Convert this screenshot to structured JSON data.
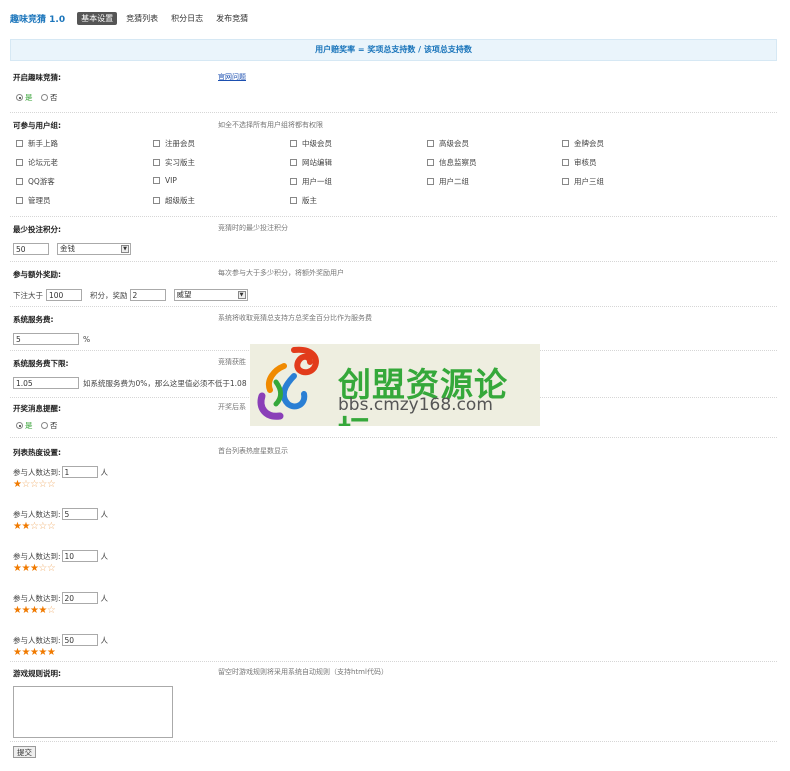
{
  "app": {
    "title": "趣味竞猜 1.0"
  },
  "tabs": [
    {
      "label": "基本设置",
      "active": true
    },
    {
      "label": "竞猜列表",
      "active": false
    },
    {
      "label": "积分日志",
      "active": false
    },
    {
      "label": "发布竞猜",
      "active": false
    }
  ],
  "banner": "用户赔奖率 = 奖项总支持数 / 该项总支持数",
  "enable": {
    "label": "开启趣味竞猜:",
    "link": "官网问题",
    "yes": "是",
    "no": "否",
    "selected": "yes"
  },
  "groups": {
    "label": "可参与用户组:",
    "desc": "如全不选择所有用户组将都有权限",
    "items": [
      "新手上路",
      "注册会员",
      "中级会员",
      "高级会员",
      "金牌会员",
      "论坛元老",
      "实习版主",
      "网站编辑",
      "信息监察员",
      "审核员",
      "QQ游客",
      "VIP",
      "用户一组",
      "用户二组",
      "用户三组",
      "管理员",
      "超级版主",
      "版主"
    ]
  },
  "min_bet": {
    "label": "最少投注积分:",
    "desc": "竞猜时的最少投注积分",
    "value": "50",
    "currency": "金钱"
  },
  "extra": {
    "label": "参与额外奖励:",
    "desc": "每次参与大于多少积分，将额外奖励用户",
    "prefix": "下注大于",
    "value": "100",
    "middle": "积分，奖励",
    "reward": "2",
    "currency": "威望"
  },
  "fee": {
    "label": "系统服务费:",
    "desc": "系统将收取竞猜总支持方总奖金百分比作为服务费",
    "value": "5",
    "unit": "%"
  },
  "fee_min": {
    "label": "系统服务费下限:",
    "desc": "竞猜获胜",
    "value": "1.05",
    "note": "如系统服务费为0%，那么这里值必须不低于1.08"
  },
  "notify": {
    "label": "开奖消息提醒:",
    "desc": "开奖后系",
    "yes": "是",
    "no": "否",
    "selected": "yes"
  },
  "hot": {
    "label": "列表热度设置:",
    "desc": "首台列表热度星数显示",
    "item_prefix": "参与人数达到:",
    "item_unit": "人",
    "levels": [
      {
        "value": "1",
        "stars": 1
      },
      {
        "value": "5",
        "stars": 2
      },
      {
        "value": "10",
        "stars": 3
      },
      {
        "value": "20",
        "stars": 4
      },
      {
        "value": "50",
        "stars": 5
      }
    ]
  },
  "rules": {
    "label": "游戏规则说明:",
    "desc": "留空时游戏规则将采用系统自动规则（支持html代码）"
  },
  "submit": "提交",
  "watermark": {
    "title": "创盟资源论坛",
    "url": "bbs.cmzy168.com"
  },
  "colors": {
    "accent": "#1b75bb",
    "star": "#f07a00",
    "banner_bg": "#eaf4fb",
    "watermark_green": "#35a83a"
  }
}
